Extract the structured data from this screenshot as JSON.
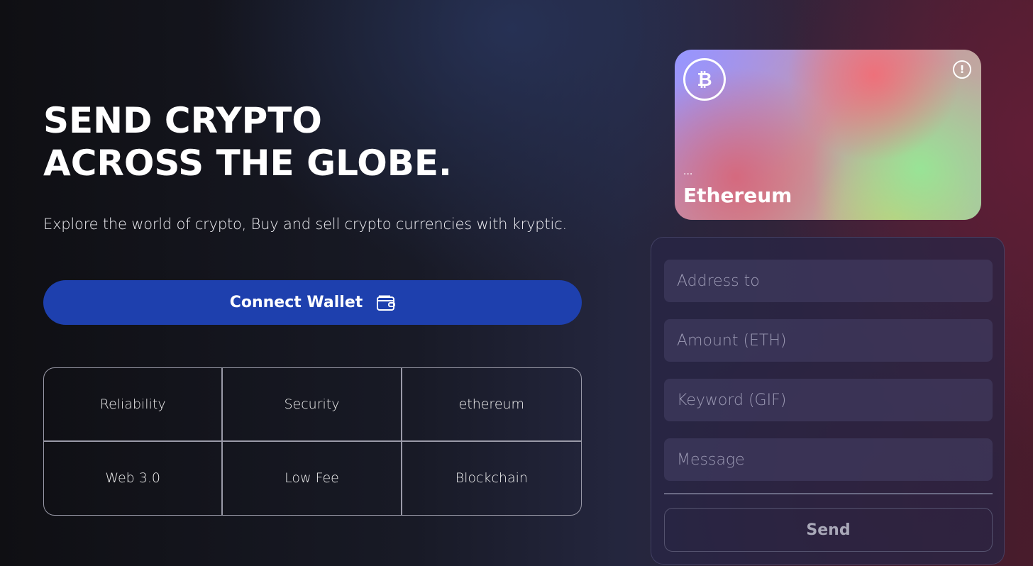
{
  "hero": {
    "title_line1": "SEND CRYPTO",
    "title_line2": "ACROSS THE GLOBE.",
    "subtitle": "Explore the world of crypto, Buy and sell crypto currencies with kryptic.",
    "connect_label": "Connect Wallet"
  },
  "features": [
    "Reliability",
    "Security",
    "ethereum",
    "Web 3.0",
    "Low Fee",
    "Blockchain"
  ],
  "card": {
    "address": "...",
    "network": "Ethereum",
    "coin_icon": "bitcoin-icon",
    "info_icon": "info-icon"
  },
  "form": {
    "address_placeholder": "Address to",
    "amount_placeholder": "Amount (ETH)",
    "keyword_placeholder": "Keyword (GIF)",
    "message_placeholder": "Message",
    "send_label": "Send"
  },
  "colors": {
    "accent": "#1e40ae"
  }
}
